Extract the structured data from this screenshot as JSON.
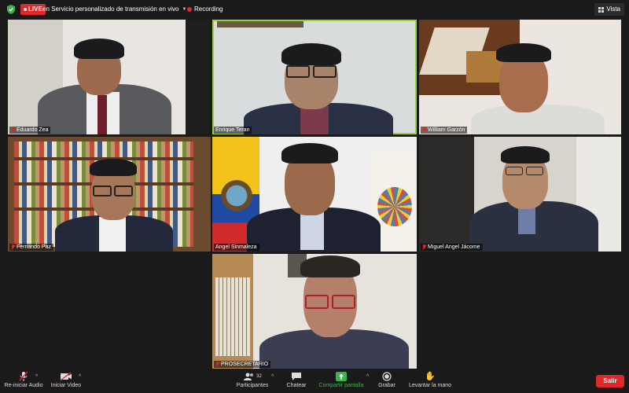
{
  "topbar": {
    "live_label": "LIVE",
    "stream_label": "en Servicio personalizado de transmisión en vivo",
    "recording_label": "Recording",
    "view_label": "Vista"
  },
  "participants": [
    {
      "name": "Eduardo Zea"
    },
    {
      "name": "Enrique Teran"
    },
    {
      "name": "William Garzón"
    },
    {
      "name": "Fernando Paz"
    },
    {
      "name": "Angel Sinmaleza"
    },
    {
      "name": "Miguel Angel Jácome"
    },
    {
      "name": "PROSECRETARIO"
    }
  ],
  "toolbar": {
    "audio_label": "Re-iniciar Audio",
    "video_label": "Iniciar Video",
    "participants_label": "Participantes",
    "participants_count": "32",
    "chat_label": "Chatear",
    "share_label": "Compartir pantalla",
    "record_label": "Grabar",
    "raise_hand_label": "Levantar la mano",
    "leave_label": "Salir"
  },
  "colors": {
    "live_red": "#e02828",
    "active_speaker": "#9bd23c",
    "share_green": "#3bb54a"
  }
}
